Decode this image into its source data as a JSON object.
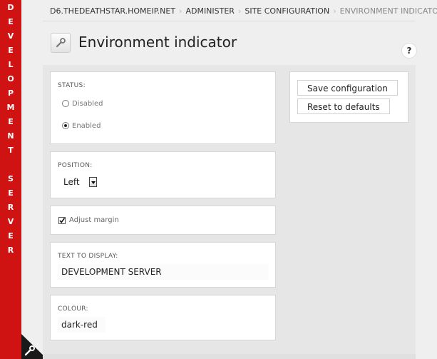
{
  "environment_bar": {
    "letters": [
      "D",
      "E",
      "V",
      "E",
      "L",
      "O",
      "P",
      "M",
      "E",
      "N",
      "T",
      " ",
      "S",
      "E",
      "R",
      "V",
      "E",
      "R"
    ],
    "color": "#cf1313"
  },
  "breadcrumb": {
    "items": [
      "D6.THEDEATHSTAR.HOMEIP.NET",
      "ADMINISTER",
      "SITE CONFIGURATION",
      "ENVIRONMENT INDICATOR"
    ],
    "separator": "›"
  },
  "page": {
    "title": "Environment indicator",
    "icon": "wrench-icon",
    "help": "?"
  },
  "form": {
    "status": {
      "label": "STATUS:",
      "options": [
        {
          "label": "Disabled",
          "checked": false
        },
        {
          "label": "Enabled",
          "checked": true
        }
      ]
    },
    "position": {
      "label": "POSITION:",
      "selected": "Left"
    },
    "adjust_margin": {
      "label": "Adjust margin",
      "checked": true
    },
    "text_to_display": {
      "label": "TEXT TO DISPLAY:",
      "value": "DEVELOPMENT SERVER"
    },
    "colour": {
      "label": "COLOUR:",
      "value": "dark-red"
    }
  },
  "actions": {
    "save_label": "Save configuration",
    "reset_label": "Reset to defaults"
  }
}
